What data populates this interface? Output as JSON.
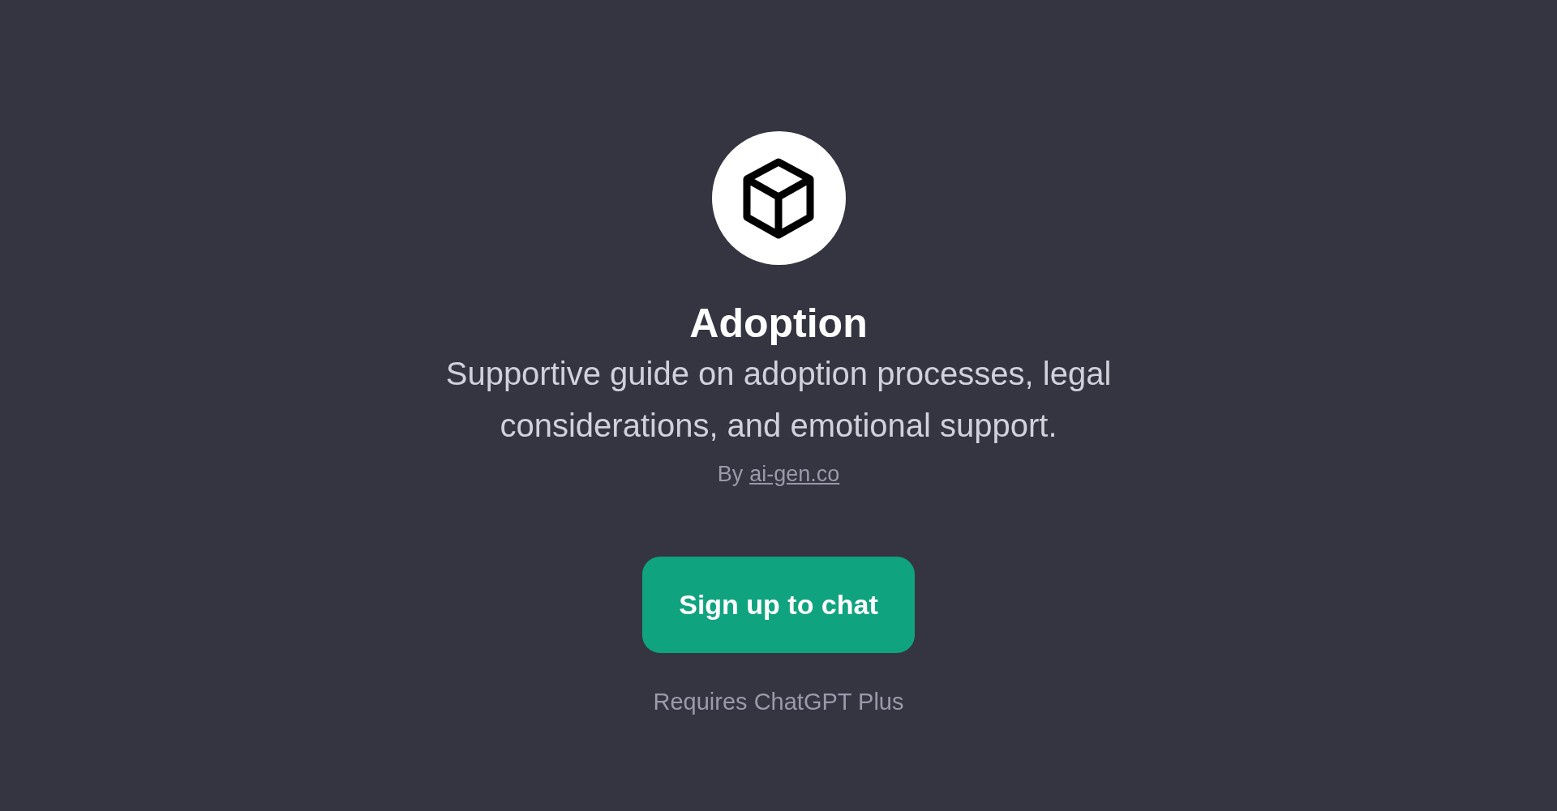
{
  "gpt": {
    "title": "Adoption",
    "description": "Supportive guide on adoption processes, legal considerations, and emotional support.",
    "by_label": "By",
    "author": "ai-gen.co"
  },
  "signup_button": "Sign up to chat",
  "requirement": "Requires ChatGPT Plus"
}
